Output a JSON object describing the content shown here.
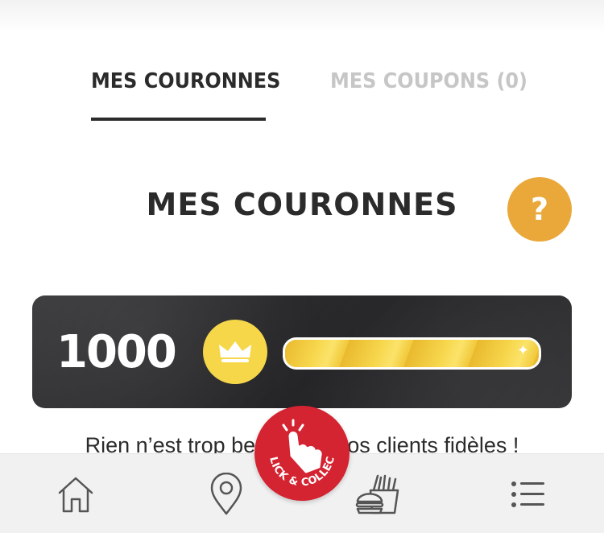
{
  "tabs": [
    {
      "label": "MES COURONNES",
      "active": true
    },
    {
      "label": "MES COUPONS (0)",
      "active": false
    }
  ],
  "section": {
    "title": "MES COURONNES",
    "help_label": "?"
  },
  "points": {
    "value": "1000",
    "progress_fraction": 1.0
  },
  "subtitle": "Rien n’est trop beau pour nos clients fidèles !",
  "bottom_nav": {
    "items": [
      {
        "icon": "home-icon"
      },
      {
        "icon": "location-pin-icon"
      },
      {
        "icon": "burger-fries-icon"
      },
      {
        "icon": "list-menu-icon"
      }
    ],
    "click_collect": {
      "top_text": "CLICK",
      "ampersand": "&",
      "bottom_text": "COLLECT"
    }
  },
  "colors": {
    "accent_orange": "#eaa83a",
    "crown_yellow": "#f6d74a",
    "brand_red": "#d42331",
    "text_dark": "#2b2b2b",
    "tab_inactive": "#c6c6c6"
  }
}
